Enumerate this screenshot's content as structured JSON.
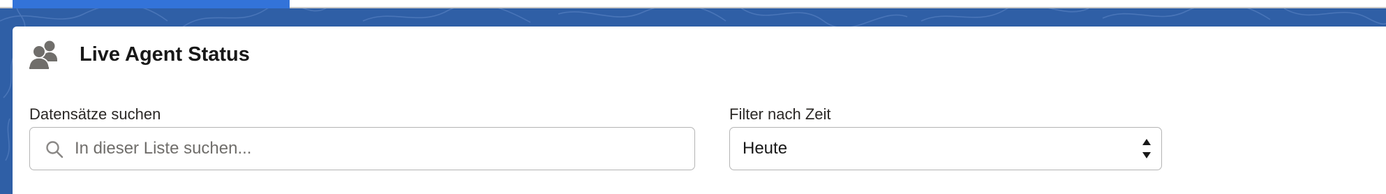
{
  "page_progress": {
    "percent": 20
  },
  "card": {
    "title": "Live Agent Status",
    "icon": "users-icon"
  },
  "search": {
    "label": "Datensätze suchen",
    "placeholder": "In dieser Liste suchen...",
    "value": "",
    "icon": "search-icon"
  },
  "time_filter": {
    "label": "Filter nach Zeit",
    "selected": "Heute",
    "icon": "select-arrows-icon"
  },
  "colors": {
    "brand_background": "#2f5fa6",
    "progress_accent": "#3373d9",
    "icon_gray": "#706e6b"
  }
}
